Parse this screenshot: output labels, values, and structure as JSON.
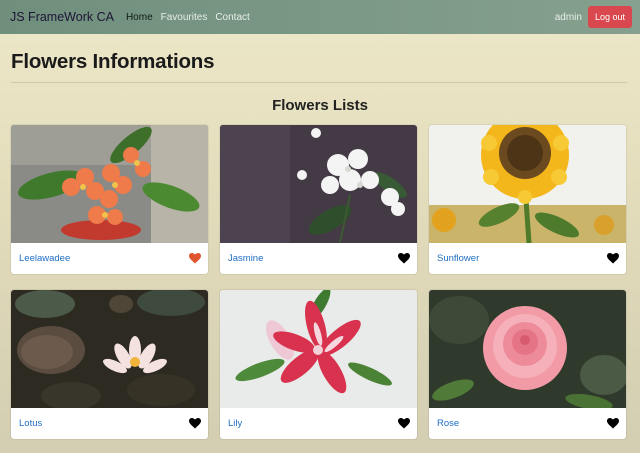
{
  "nav": {
    "brand": "JS FrameWork CA",
    "links": [
      "Home",
      "Favourites",
      "Contact"
    ],
    "active": "Home",
    "user": "admin",
    "logout_label": "Log out"
  },
  "page": {
    "title": "Flowers Informations",
    "section_title": "Flowers Lists"
  },
  "colors": {
    "navbar": "#7a9684",
    "logout": "#d9484f",
    "link": "#1f6ec4",
    "heart_favourite": "#e0552e",
    "heart_default": "#000000"
  },
  "flowers": [
    {
      "name": "Leelawadee",
      "favourite": true,
      "heart_icon": "heart-icon"
    },
    {
      "name": "Jasmine",
      "favourite": false,
      "heart_icon": "heart-icon"
    },
    {
      "name": "Sunflower",
      "favourite": false,
      "heart_icon": "heart-icon"
    },
    {
      "name": "Lotus",
      "favourite": false,
      "heart_icon": "heart-icon"
    },
    {
      "name": "Lily",
      "favourite": false,
      "heart_icon": "heart-icon"
    },
    {
      "name": "Rose",
      "favourite": false,
      "heart_icon": "heart-icon"
    }
  ]
}
